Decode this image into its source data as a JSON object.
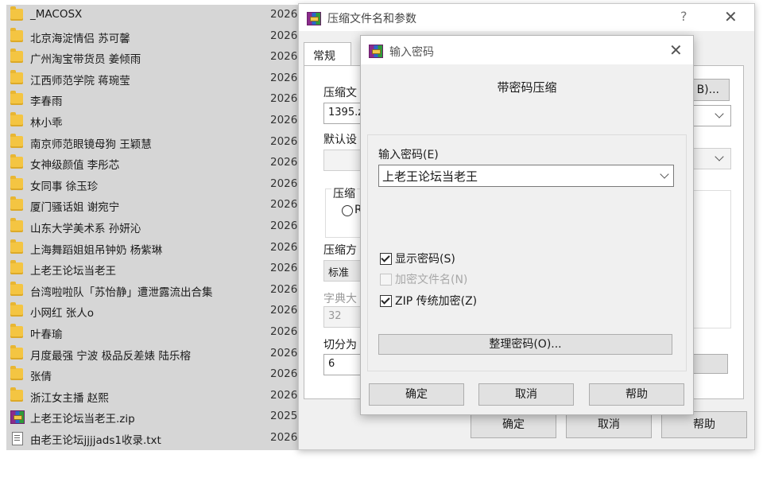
{
  "file_list": {
    "items": [
      {
        "name": "_MACOSX",
        "date": "2026",
        "type": "folder"
      },
      {
        "name": "北京海淀情侣 苏可馨",
        "date": "2026",
        "type": "folder"
      },
      {
        "name": "广州淘宝带货员 姜倾雨",
        "date": "2026",
        "type": "folder"
      },
      {
        "name": "江西师范学院 蒋琬莹",
        "date": "2026",
        "type": "folder"
      },
      {
        "name": "李春雨",
        "date": "2026",
        "type": "folder"
      },
      {
        "name": "林小乖",
        "date": "2026",
        "type": "folder"
      },
      {
        "name": "南京师范眼镜母狗 王颖慧",
        "date": "2026",
        "type": "folder"
      },
      {
        "name": "女神级颜值 李彤芯",
        "date": "2026",
        "type": "folder"
      },
      {
        "name": "女同事 徐玉珍",
        "date": "2026",
        "type": "folder"
      },
      {
        "name": "厦门骚话姐 谢宛宁",
        "date": "2026",
        "type": "folder"
      },
      {
        "name": "山东大学美术系 孙妍沁",
        "date": "2026",
        "type": "folder"
      },
      {
        "name": "上海舞蹈姐姐吊钟奶 杨紫琳",
        "date": "2026",
        "type": "folder"
      },
      {
        "name": "上老王论坛当老王",
        "date": "2026",
        "type": "folder"
      },
      {
        "name": "台湾啦啦队「苏怡静」遭泄露流出合集",
        "date": "2026",
        "type": "folder"
      },
      {
        "name": "小网红 张人o",
        "date": "2026",
        "type": "folder"
      },
      {
        "name": "叶春瑜",
        "date": "2026",
        "type": "folder"
      },
      {
        "name": "月度最强 宁波 极品反差婊 陆乐榕",
        "date": "2026",
        "type": "folder"
      },
      {
        "name": "张倩",
        "date": "2026",
        "type": "folder"
      },
      {
        "name": "浙江女主播 赵熙",
        "date": "2026",
        "type": "folder"
      },
      {
        "name": "上老王论坛当老王.zip",
        "date": "2025",
        "type": "zip"
      },
      {
        "name": "由老王论坛jjjjads1收录.txt",
        "date": "2026",
        "type": "txt"
      }
    ]
  },
  "archive_dialog": {
    "title": "压缩文件名和参数",
    "help": "?",
    "close": "✕",
    "tab_general": "常规",
    "archive_name_label": "压缩文",
    "archive_name_value": "1395.z",
    "browse_button": "B)...",
    "default_profile_label": "默认设",
    "format_group_label": "压缩",
    "format_radio_label": "R",
    "method_label": "压缩方",
    "method_value": "标准",
    "dict_label": "字典大",
    "dict_value": "32",
    "split_label": "切分为",
    "split_value": "6",
    "ok": "确定",
    "cancel": "取消",
    "help_button": "帮助"
  },
  "password_dialog": {
    "title": "输入密码",
    "close": "✕",
    "heading": "带密码压缩",
    "password_label": "输入密码(E)",
    "password_value": "上老王论坛当老王",
    "show_password": "显示密码(S)",
    "encrypt_names": "加密文件名(N)",
    "zip_legacy": "ZIP 传统加密(Z)",
    "organize_button": "整理密码(O)...",
    "ok": "确定",
    "cancel": "取消",
    "help": "帮助"
  },
  "checkbox_state": {
    "show_password": true,
    "encrypt_names": false,
    "zip_legacy": true
  }
}
